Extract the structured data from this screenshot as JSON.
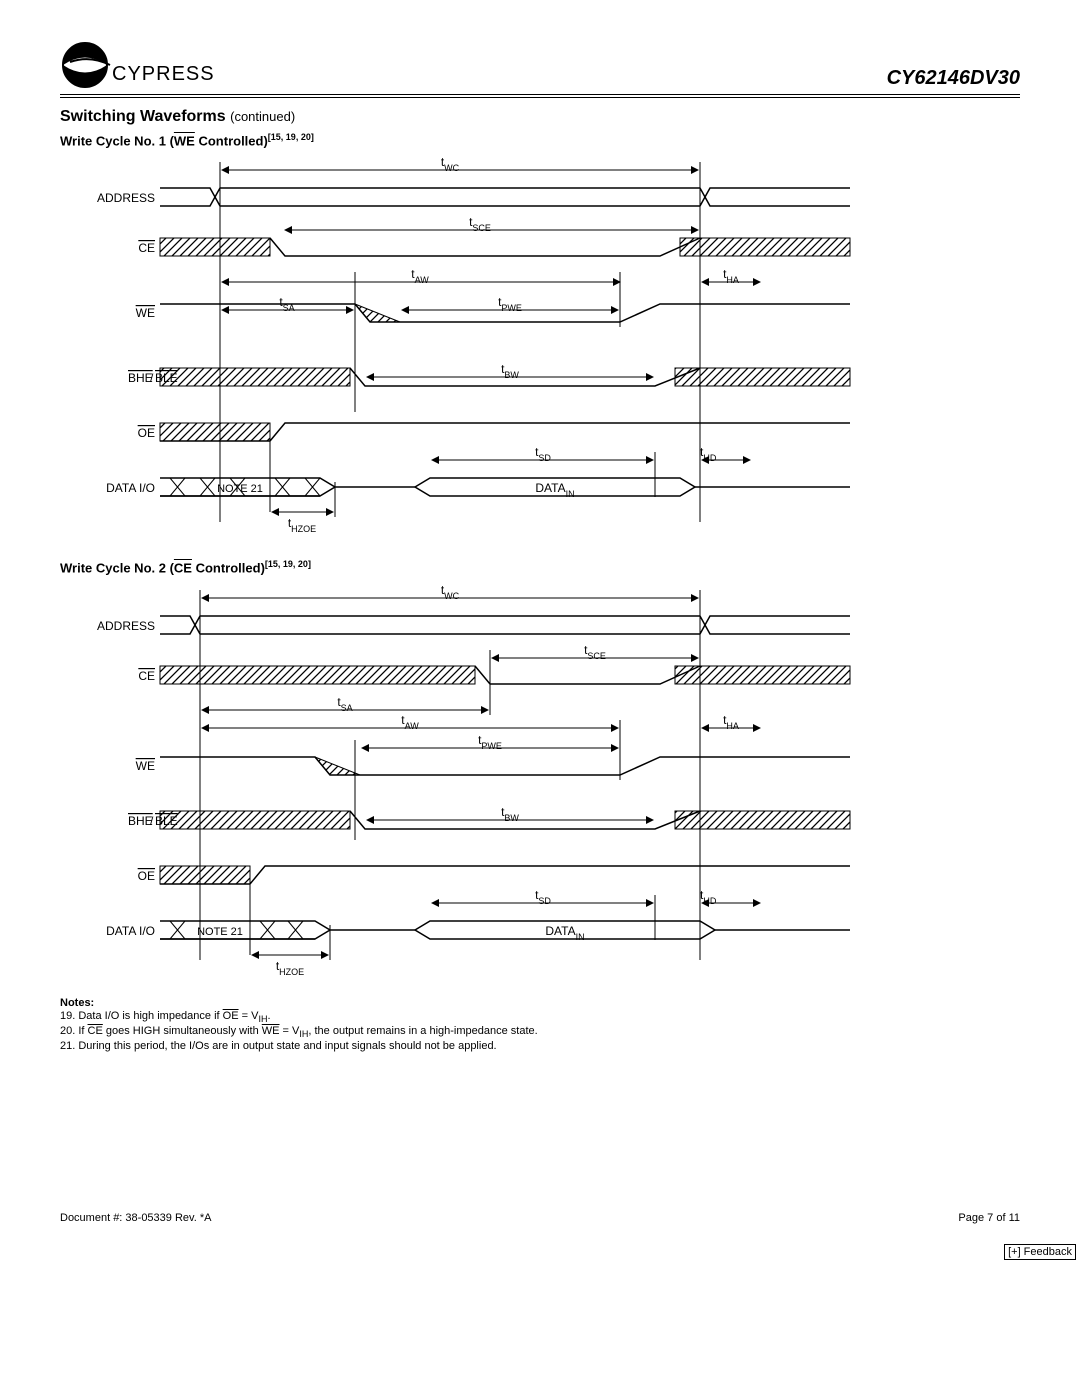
{
  "header": {
    "brand": "CYPRESS",
    "part_number": "CY62146DV30"
  },
  "section_title": "Switching Waveforms",
  "section_continued": "(continued)",
  "subtitle1_prefix": "Write Cycle No. 1 (",
  "subtitle1_signal": "WE",
  "subtitle1_suffix": " Controlled)",
  "subtitle1_refs": "[15, 19, 20]",
  "subtitle2_prefix": "Write Cycle No. 2 (",
  "subtitle2_signal": "CE",
  "subtitle2_suffix": " Controlled)",
  "subtitle2_refs": "[15, 19, 20]",
  "signals": {
    "address": "ADDRESS",
    "ce": "CE",
    "we": "WE",
    "bhe_ble": "BHE/BLE",
    "oe": "OE",
    "data_io": "DATA I/O",
    "data_io2": "DATA  I/O"
  },
  "timing_labels": {
    "tWC": "WC",
    "tSCE": "SCE",
    "tAW": "AW",
    "tHA": "HA",
    "tSA": "SA",
    "tPWE": "PWE",
    "tBW": "BW",
    "tSD": "SD",
    "tHD": "HD",
    "tHZOE": "HZOE"
  },
  "diagram_text": {
    "note21": "NOTE 21",
    "data_in": "DATA",
    "data_in_sub": "IN"
  },
  "notes": {
    "heading": "Notes:",
    "n19_a": "19. Data I/O is high impedance if ",
    "n19_b": "OE",
    "n19_c": " = V",
    "n19_d": "IH",
    "n19_e": ".",
    "n20_a": "20. If ",
    "n20_b": "CE",
    "n20_c": " goes HIGH simultaneously with ",
    "n20_d": "WE",
    "n20_e": " = V",
    "n20_f": "IH",
    "n20_g": ", the output remains in a high-impedance state.",
    "n21": "21. During this period, the I/Os are in output state and input signals should not be applied."
  },
  "footer": {
    "doc": "Document #: 38-05339 Rev. *A",
    "page": "Page 7 of 11",
    "feedback": "[+] Feedback"
  }
}
